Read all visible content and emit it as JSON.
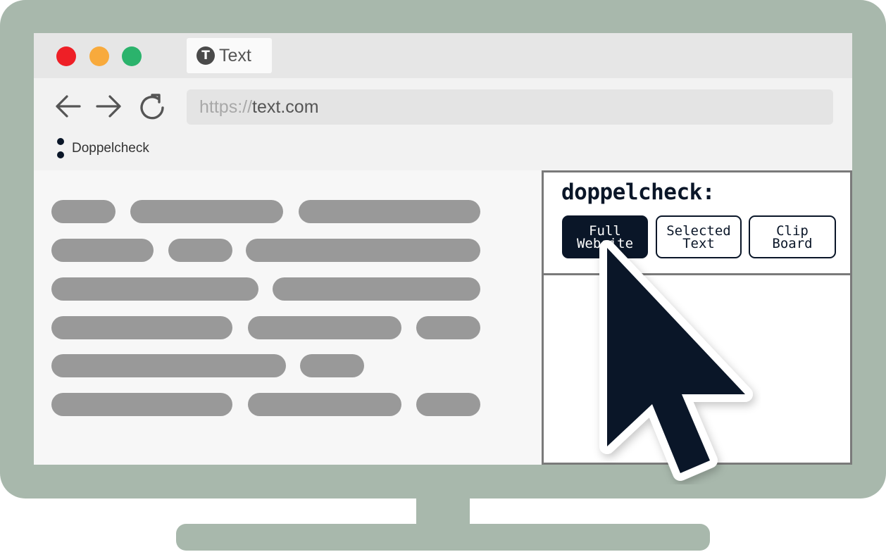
{
  "browser": {
    "tab": {
      "icon": "T",
      "label": "Text"
    },
    "window_controls": [
      "close",
      "minimize",
      "maximize"
    ],
    "nav": {
      "back_icon": "arrow-left-icon",
      "forward_icon": "arrow-right-icon",
      "reload_icon": "reload-icon"
    },
    "url": {
      "scheme": "https://",
      "host": "text.com"
    },
    "bookmark": {
      "icon": "doppelcheck-icon",
      "label": "Doppelcheck"
    }
  },
  "content": {
    "text_placeholder_rows": 6
  },
  "extension": {
    "title": "doppelcheck:",
    "buttons": [
      {
        "label": "Full\nWebsite",
        "active": true
      },
      {
        "label": "Selected\nText",
        "active": false
      },
      {
        "label": "Clip\nBoard",
        "active": false
      }
    ]
  },
  "colors": {
    "monitor": "#a8b8ac",
    "accent_dark": "#0a1628",
    "close": "#ee1f26",
    "minimize": "#f8aa3c",
    "maximize": "#2bb36c",
    "placeholder": "#999999"
  }
}
